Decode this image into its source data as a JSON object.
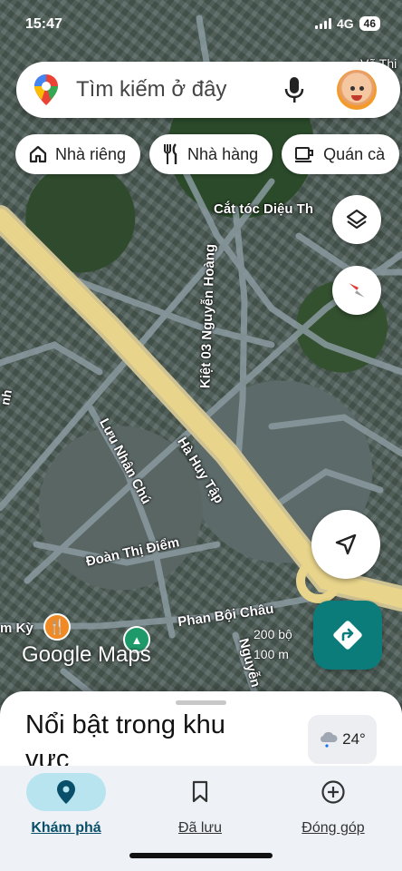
{
  "status_bar": {
    "time": "15:47",
    "network": "4G",
    "battery": "46"
  },
  "search": {
    "placeholder": "Tìm kiếm ở đây"
  },
  "chips": [
    {
      "label": "Nhà riêng",
      "icon": "home-icon"
    },
    {
      "label": "Nhà hàng",
      "icon": "restaurant-icon"
    },
    {
      "label": "Quán cà",
      "icon": "coffee-icon"
    }
  ],
  "map": {
    "labels": {
      "cat_toc": "Cắt tóc Diệu Th",
      "kiet": "Kiệt 03 Nguyễn Hoàng",
      "luu_nhan_chu": "Lưu Nhân Chú",
      "ha_huy_tap": "Hà Huy Tập",
      "doan_thi_diem": "Đoàn Thị Điểm",
      "phan_boi_chau": "Phan Bội Châu",
      "nguyen": "Nguyễn",
      "m_ky": "m Kỳ",
      "vo_thi": "Võ Thi",
      "nh": "nh"
    },
    "logo": "Google Maps",
    "scale": {
      "ft": "200 bộ",
      "m": "100 m"
    }
  },
  "bottom_sheet": {
    "title": "Nổi bật trong khu vực",
    "temperature": "24°"
  },
  "nav": [
    {
      "label": "Khám phá",
      "icon": "explore-pin-icon",
      "active": true
    },
    {
      "label": "Đã lưu",
      "icon": "bookmark-icon",
      "active": false
    },
    {
      "label": "Đóng góp",
      "icon": "add-circle-icon",
      "active": false
    }
  ],
  "colors": {
    "accent": "#0b7c7a",
    "nav_active": "#b8e4f0",
    "road": "#e8d48a"
  }
}
